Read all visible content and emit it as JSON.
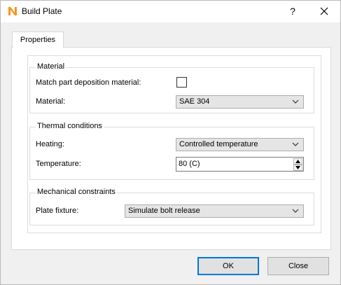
{
  "window": {
    "title": "Build Plate",
    "help_label": "?"
  },
  "tabs": [
    {
      "label": "Properties"
    }
  ],
  "material": {
    "group_title": "Material",
    "match_label": "Match part deposition material:",
    "match_checked": false,
    "material_label": "Material:",
    "material_value": "SAE 304"
  },
  "thermal": {
    "group_title": "Thermal conditions",
    "heating_label": "Heating:",
    "heating_value": "Controlled temperature",
    "temperature_label": "Temperature:",
    "temperature_value": "80 (C)"
  },
  "mechanical": {
    "group_title": "Mechanical constraints",
    "fixture_label": "Plate fixture:",
    "fixture_value": "Simulate bolt release"
  },
  "buttons": {
    "ok": "OK",
    "close": "Close"
  },
  "colors": {
    "accent": "#0078d7",
    "app_icon": "#f7941d"
  },
  "icons": {
    "app": "app-logo-icon",
    "close": "close-icon",
    "dropdown": "chevron-down-icon"
  }
}
